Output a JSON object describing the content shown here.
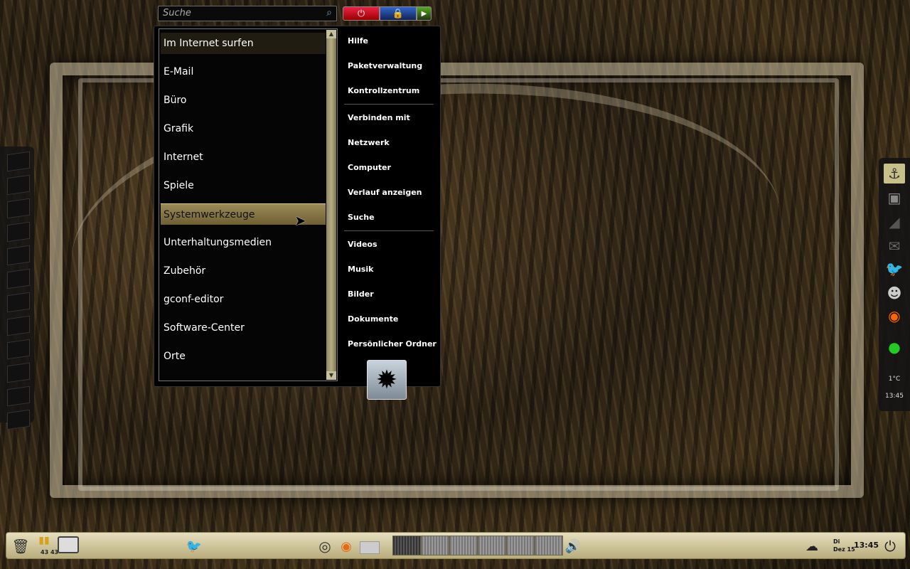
{
  "search": {
    "placeholder": "Suche",
    "value": ""
  },
  "session_buttons": [
    "power",
    "lock",
    "arrow-right"
  ],
  "categories": [
    "Im Internet surfen",
    "E-Mail",
    "Büro",
    "Grafik",
    "Internet",
    "Spiele",
    "Systemwerkzeuge",
    "Unterhaltungsmedien",
    "Zubehör",
    "gconf-editor",
    "Software-Center",
    "Orte"
  ],
  "hovered_category": "Im Internet surfen",
  "active_category": "Systemwerkzeuge",
  "places": {
    "group1": [
      "Hilfe",
      "Paketverwaltung",
      "Kontrollzentrum"
    ],
    "group2": [
      "Verbinden mit",
      "Netzwerk",
      "Computer",
      "Verlauf anzeigen",
      "Suche"
    ],
    "group3": [
      "Videos",
      "Musik",
      "Bilder",
      "Dokumente",
      "Persönlicher Ordner"
    ]
  },
  "right_dock": {
    "temperature": "1°C",
    "time": "13:45",
    "icons": [
      "anchor-icon",
      "camera-icon",
      "screen-icon",
      "mail-icon",
      "bird-icon",
      "gimp-icon",
      "firefox-icon",
      "green-dot-icon"
    ]
  },
  "panel": {
    "cpu": [
      "43",
      "43"
    ],
    "clock": "13:45",
    "day": "Di",
    "date": "Dez 15",
    "workspaces": 6,
    "current_workspace": 1,
    "icons": [
      "trash-icon",
      "cpu-monitor-icon",
      "network-monitor-icon",
      "bird-icon",
      "ubuntu-icon",
      "firefox-icon",
      "window-icon",
      "volume-icon",
      "weather-icon",
      "power-icon"
    ]
  },
  "colors": {
    "accent": "#9c8b58",
    "panel": "#d8d0a8",
    "menu_bg": "#000000"
  }
}
